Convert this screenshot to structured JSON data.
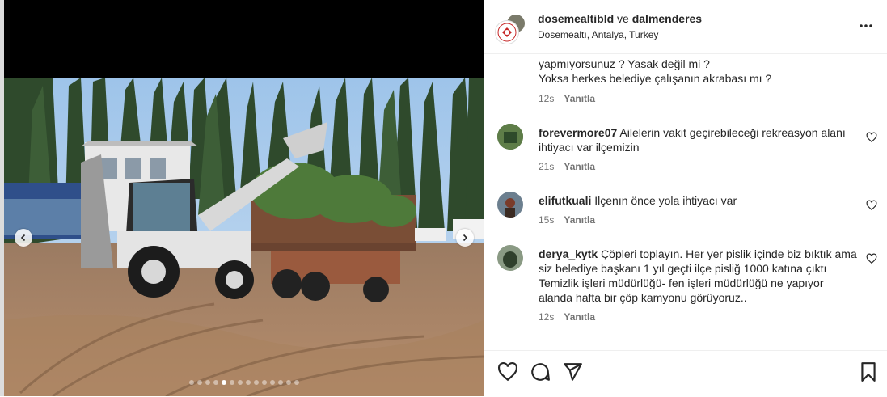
{
  "post": {
    "header": {
      "user1": "dosemealtibld",
      "connector": "ve",
      "user2": "dalmenderes",
      "location": "Dosemealtı, Antalya, Turkey"
    },
    "carousel": {
      "slides": 14,
      "active_slide": 4
    },
    "first_comment": {
      "lines": [
        "yapmıyorsunuz ? Yasak değil mi ?",
        "Yoksa herkes belediye çalışanın akrabası mı ?"
      ],
      "time": "12s",
      "reply": "Yanıtla"
    },
    "comments": [
      {
        "username": "forevermore07",
        "text": "Ailelerin vakit geçirebileceği rekreasyon alanı ihtiyacı var ilçemizin",
        "time": "21s",
        "reply": "Yanıtla"
      },
      {
        "username": "elifutkuali",
        "text": "Ilçenın önce yola ihtiyacı var",
        "time": "15s",
        "reply": "Yanıtla"
      },
      {
        "username": "derya_kytk",
        "text": "Çöpleri toplayın. Her yer pislik içinde biz bıktık ama siz belediye başkanı 1 yıl geçti ilçe pisliğ 1000 katına çıktı Temizlik işleri müdürlüğü- fen işleri müdürlüğü ne yapıyor alanda hafta bir çöp kamyonu görüyoruz..",
        "time": "12s",
        "reply": "Yanıtla"
      }
    ]
  },
  "icons": [
    "chevron-left-icon",
    "chevron-right-icon",
    "more-icon",
    "heart-icon",
    "comment-icon",
    "share-icon",
    "save-icon"
  ],
  "colors": {
    "text": "#262626",
    "secondary": "#737373",
    "border": "#efefef"
  }
}
